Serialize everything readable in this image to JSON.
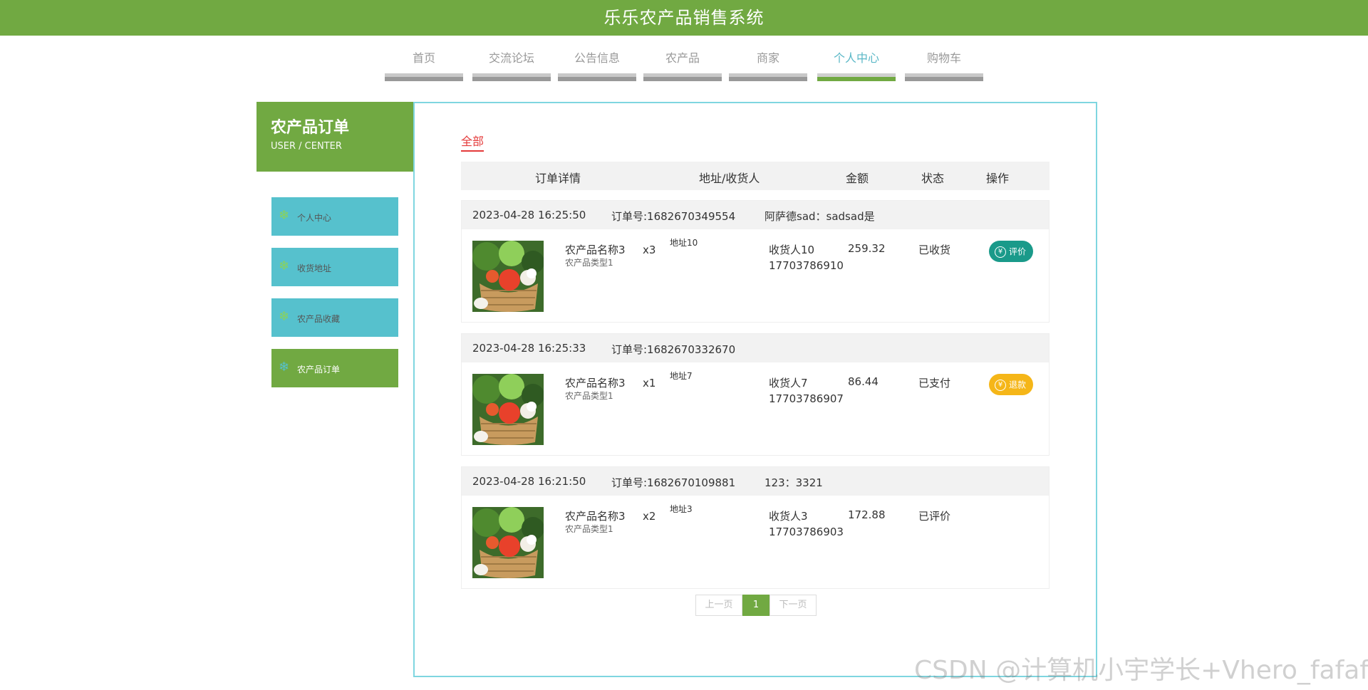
{
  "app": {
    "title": "乐乐农产品销售系统"
  },
  "nav": {
    "tabs": [
      {
        "label": "首页"
      },
      {
        "label": "交流论坛"
      },
      {
        "label": "公告信息"
      },
      {
        "label": "农产品"
      },
      {
        "label": "商家"
      },
      {
        "label": "个人中心",
        "active": true
      },
      {
        "label": "购物车"
      }
    ]
  },
  "sidebar": {
    "title": "农产品订单",
    "subtitle": "USER / CENTER",
    "items": [
      {
        "label": "个人中心"
      },
      {
        "label": "收货地址"
      },
      {
        "label": "农产品收藏"
      },
      {
        "label": "农产品订单",
        "active": true
      }
    ],
    "item_icon": "snowflake-icon"
  },
  "main": {
    "filter_label": "全部",
    "columns": [
      "订单详情",
      "地址/收货人",
      "金额",
      "状态",
      "操作"
    ],
    "orders": [
      {
        "time": "2023-04-28 16:25:50",
        "order_no": "订单号:1682670349554",
        "note": "阿萨德sad：sadsad是",
        "product_name": "农产品名称3",
        "product_type": "农产品类型1",
        "qty": "x3",
        "address": "地址10",
        "receiver": "收货人10",
        "phone": "17703786910",
        "amount": "259.32",
        "status": "已收货",
        "action": {
          "label": "评价",
          "icon": "yen-icon",
          "color": "#1a9a8a"
        }
      },
      {
        "time": "2023-04-28 16:25:33",
        "order_no": "订单号:1682670332670",
        "note": "",
        "product_name": "农产品名称3",
        "product_type": "农产品类型1",
        "qty": "x1",
        "address": "地址7",
        "receiver": "收货人7",
        "phone": "17703786907",
        "amount": "86.44",
        "status": "已支付",
        "action": {
          "label": "退款",
          "icon": "yen-icon",
          "color": "#f5b618"
        }
      },
      {
        "time": "2023-04-28 16:21:50",
        "order_no": "订单号:1682670109881",
        "note": "123：3321",
        "product_name": "农产品名称3",
        "product_type": "农产品类型1",
        "qty": "x2",
        "address": "地址3",
        "receiver": "收货人3",
        "phone": "17703786903",
        "amount": "172.88",
        "status": "已评价",
        "action": null
      }
    ],
    "pager": {
      "prev": "上一页",
      "current": "1",
      "next": "下一页"
    }
  },
  "watermark": "CSDN @计算机小宇学长+Vhero_fafafa",
  "colors": {
    "brand_green": "#71a942",
    "menu_teal": "#56c1cd",
    "border_cyan": "#7fd6e0",
    "filter_red": "#e43a3a"
  }
}
